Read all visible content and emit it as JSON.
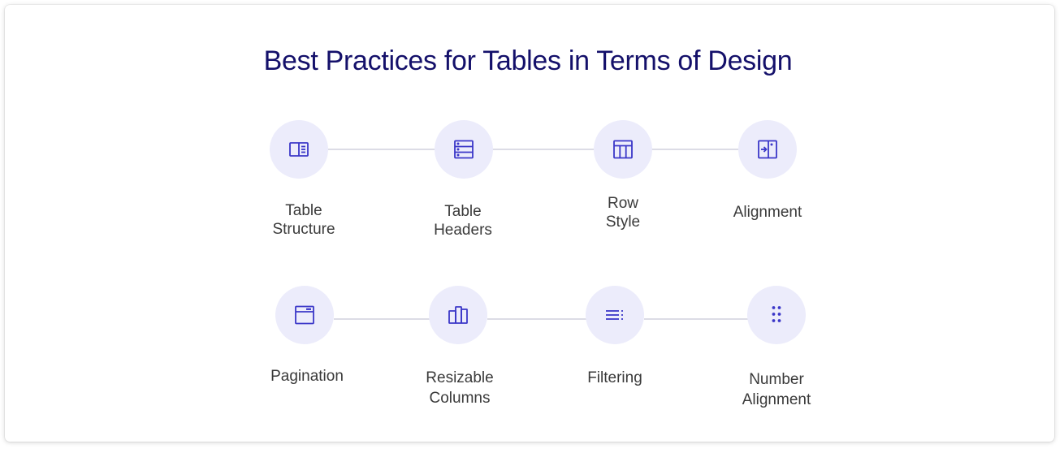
{
  "title": "Best Practices for Tables in Terms of Design",
  "colors": {
    "title": "#14106a",
    "icon": "#3b37c8",
    "node_bg": "#ececfb",
    "connector": "#dcdce6",
    "label": "#3a3a3a"
  },
  "rows": [
    {
      "items": [
        {
          "label": "Table\nStructure",
          "icon": "layout-sidebar-icon"
        },
        {
          "label": "Table\nHeaders",
          "icon": "server-list-icon"
        },
        {
          "label": "Row\nStyle",
          "icon": "table-grid-icon"
        },
        {
          "label": "Alignment",
          "icon": "align-right-panel-icon"
        }
      ]
    },
    {
      "items": [
        {
          "label": "Pagination",
          "icon": "window-icon"
        },
        {
          "label": "Resizable\nColumns",
          "icon": "columns-icon"
        },
        {
          "label": "Filtering",
          "icon": "filter-list-icon"
        },
        {
          "label": "Number\nAlignment",
          "icon": "dots-grid-icon"
        }
      ]
    }
  ]
}
